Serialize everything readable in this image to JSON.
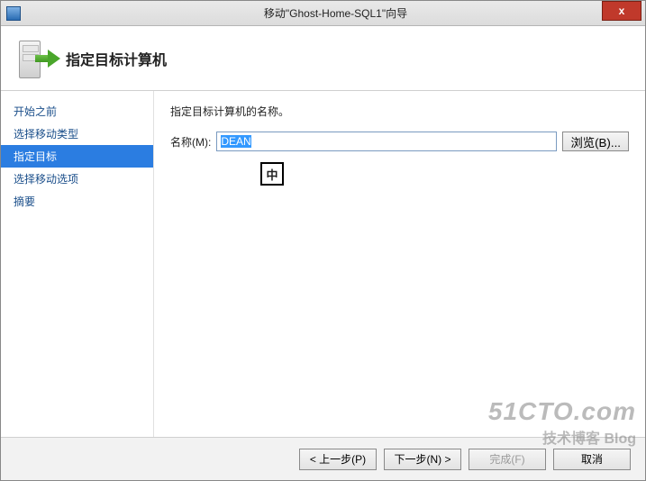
{
  "titlebar": {
    "title": "移动\"Ghost-Home-SQL1\"向导",
    "close_glyph": "x"
  },
  "header": {
    "title": "指定目标计算机"
  },
  "sidebar": {
    "items": [
      {
        "label": "开始之前",
        "selected": false
      },
      {
        "label": "选择移动类型",
        "selected": false
      },
      {
        "label": "指定目标",
        "selected": true
      },
      {
        "label": "选择移动选项",
        "selected": false
      },
      {
        "label": "摘要",
        "selected": false
      }
    ]
  },
  "main": {
    "instruction": "指定目标计算机的名称。",
    "name_label": "名称(M):",
    "name_value": "DEAN",
    "browse_label": "浏览(B)...",
    "ime_indicator": "中"
  },
  "footer": {
    "prev_label": "< 上一步(P)",
    "next_label": "下一步(N) >",
    "finish_label": "完成(F)",
    "cancel_label": "取消"
  },
  "watermark": {
    "line1": "51CTO.com",
    "line2": "技术博客 Blog"
  }
}
